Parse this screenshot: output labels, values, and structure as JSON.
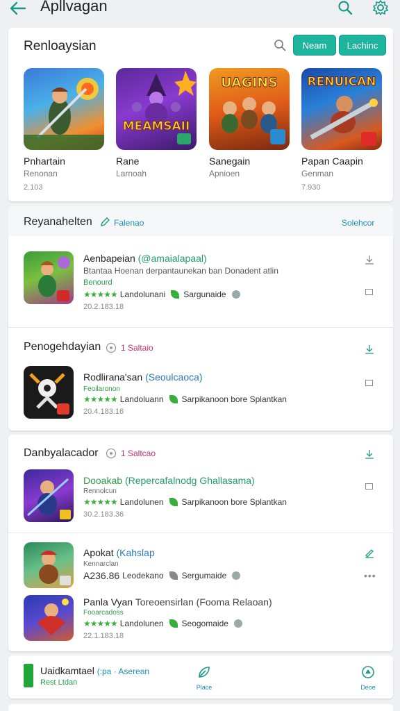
{
  "header": {
    "title": "Apllvagan"
  },
  "recommend": {
    "title": "Renloaysian",
    "btn1": "Neam",
    "btn2": "Lachinc",
    "tiles": [
      {
        "name": "Pnhartain",
        "sub": "Renonan",
        "size": "2.103",
        "art": ""
      },
      {
        "name": "Rane",
        "sub": "Larnoah",
        "size": "",
        "art": "MEAMSAII"
      },
      {
        "name": "Sanegain",
        "sub": "Apnioen",
        "size": "",
        "art": "UAGINS"
      },
      {
        "name": "Papan Caapin",
        "sub": "Genman",
        "size": "7.930",
        "art": "RENUICAN"
      }
    ]
  },
  "section1": {
    "title": "Reyanahelten",
    "tag": "Falenao",
    "link": "Solehcor"
  },
  "apps": [
    {
      "title": "Aenbapeian",
      "paren": "(@amaialapaal)",
      "desc": "Btantaa Hoenan  derpantaunekan ban Donadent atlin",
      "dev": "Benourd",
      "rating_label": "Landolunani",
      "tag": "Sargunaide",
      "size": "20.2.183.18"
    },
    {
      "section": "Penogehdayian",
      "section_tag": "1 Saltaio",
      "title": "Rodlirana'san",
      "paren": "(Seoulcaoca)",
      "dev": "Feoilaronon",
      "rating_label": "Landoluann",
      "tag": "Sarpikanoon bore Splantkan",
      "size": "20.4.183.16"
    },
    {
      "section": "Danbyalacador",
      "section_tag": "1 Saltcao",
      "title": "Dooakab",
      "paren": "(Repercafalnodg Ghallasama)",
      "dev": "Rennolcun",
      "rating_label": "Landolunen",
      "tag": "Sarpikanoon bore Splantkan",
      "size": "30.2.183.36"
    },
    {
      "title": "Apokat",
      "paren": "(Kahslap",
      "dev": "Kennarclan",
      "price": "A236.86",
      "rating_label": "Leodekano",
      "tag": "Sergumaide",
      "size": ""
    },
    {
      "title": "Panla Vyan",
      "paren": "Toreoensirlan (Fooma Relaoan)",
      "dev": "Fooarcadoss",
      "rating_label": "Landolunen",
      "tag": "Seogomaide",
      "size": "22.1.183.18"
    }
  ],
  "bottom": {
    "title": "Uaidkamtael",
    "tag": "(:pa · Aserean",
    "sub": "Rest Ltdan",
    "nav1": "Place",
    "nav2": "Deoe"
  }
}
